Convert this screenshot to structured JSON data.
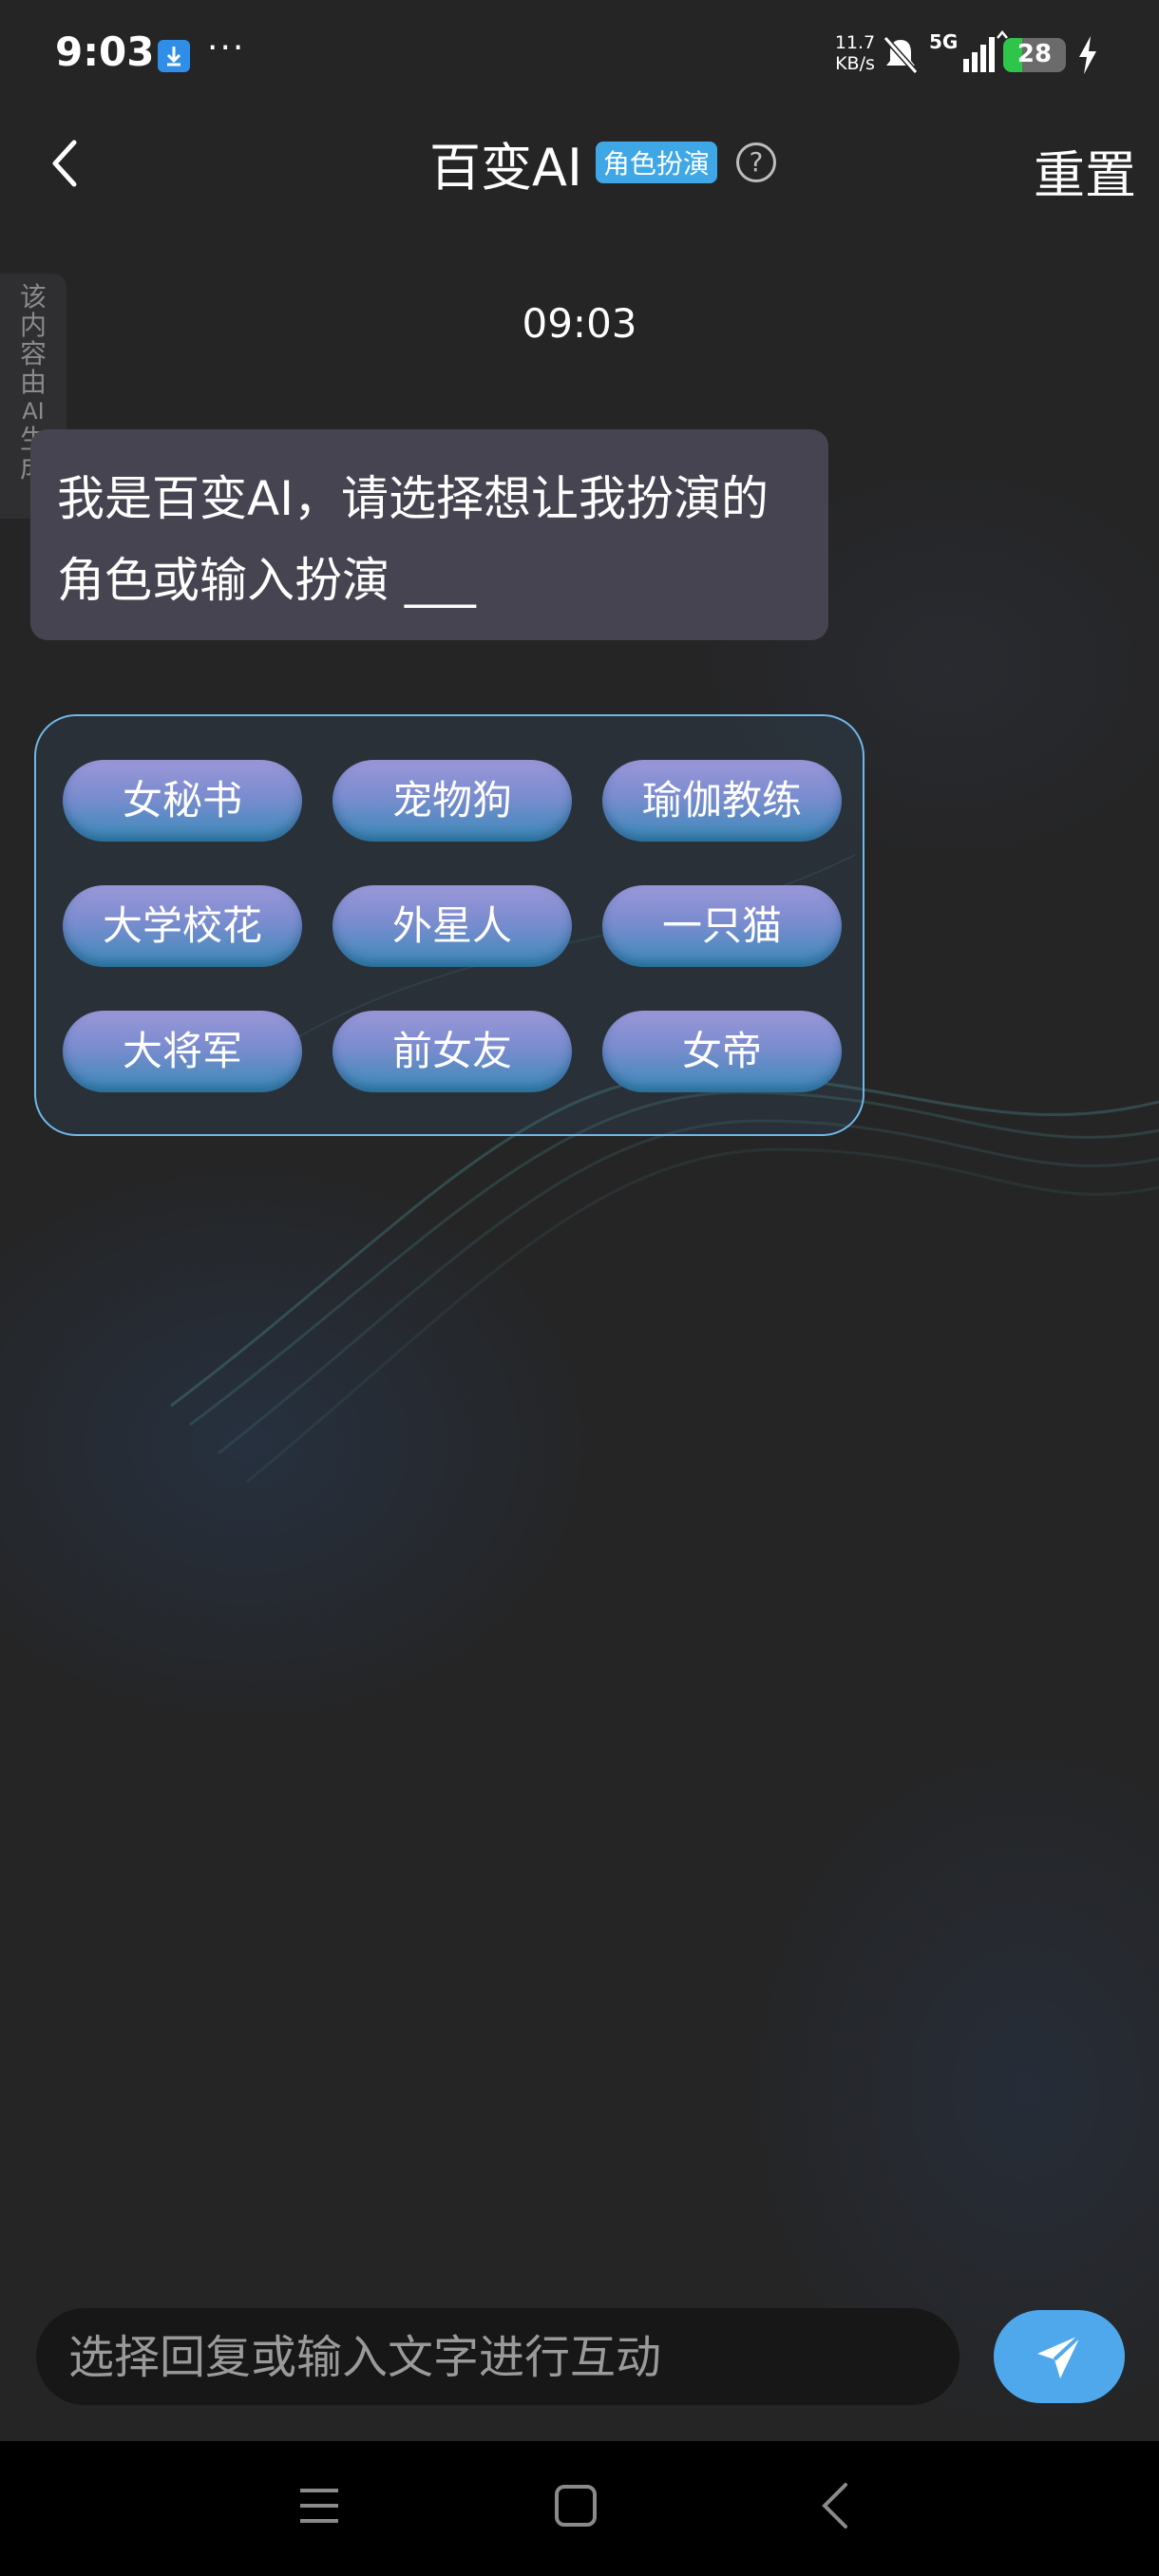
{
  "status_bar": {
    "time": "9:03",
    "more_dots": "···",
    "speed_value": "11.7",
    "speed_unit": "KB/s",
    "network": "5G",
    "battery": "28"
  },
  "header": {
    "title": "百变AI",
    "badge": "角色扮演",
    "help": "?",
    "reset_label": "重置"
  },
  "side_tag": [
    "该",
    "内",
    "容",
    "由",
    "AI",
    "生",
    "成"
  ],
  "chat": {
    "timestamp": "09:03",
    "message": "我是百变AI，请选择想让我扮演的角色或输入扮演 ___"
  },
  "options": [
    "女秘书",
    "宠物狗",
    "瑜伽教练",
    "大学校花",
    "外星人",
    "一只猫",
    "大将军",
    "前女友",
    "女帝"
  ],
  "input": {
    "placeholder": "选择回复或输入文字进行互动"
  },
  "colors": {
    "background": "#252526",
    "bubble": "#464450",
    "accent": "#4fa8ec",
    "badge": "#3fa7e6"
  }
}
